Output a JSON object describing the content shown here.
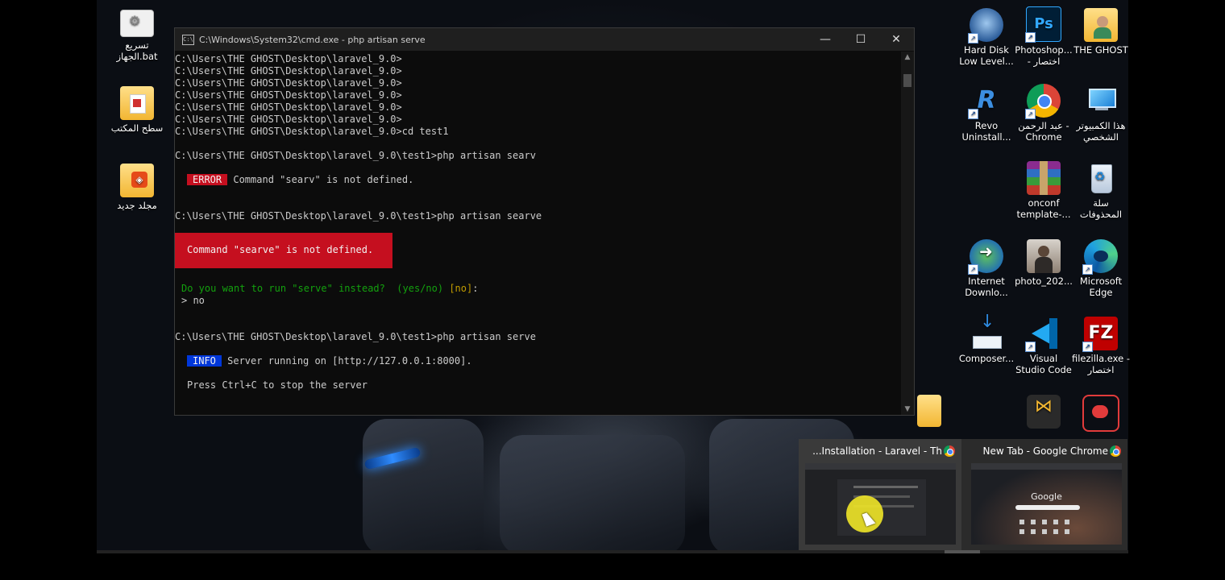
{
  "desktop_icons": {
    "left": [
      {
        "label": "تسريع الجهاز.bat"
      },
      {
        "label": "سطح المكتب"
      },
      {
        "label": "مجلد جديد"
      }
    ],
    "right": [
      {
        "label": "Hard Disk Low Level..."
      },
      {
        "label": "Photoshop... - اختصار"
      },
      {
        "label": "THE GHOST"
      },
      {
        "label": "Revo Uninstall..."
      },
      {
        "label": "عبد الرحمن - Chrome"
      },
      {
        "label": "هذا الكمبيوتر الشخصي"
      },
      {
        "label": "onconf template-..."
      },
      {
        "label": "سلة المحذوفات"
      },
      {
        "label": "Internet Downlo..."
      },
      {
        "label": "photo_202..."
      },
      {
        "label": "Microsoft Edge"
      },
      {
        "label": "Composer..."
      },
      {
        "label": "Visual Studio Code"
      },
      {
        "label": "filezilla.exe - اختصار"
      }
    ]
  },
  "cmd_window": {
    "title": "C:\\Windows\\System32\\cmd.exe - php  artisan serve",
    "minimize": "—",
    "maximize": "☐",
    "close": "✕",
    "lines": {
      "l1": "C:\\Users\\THE GHOST\\Desktop\\laravel_9.0>",
      "l2": "C:\\Users\\THE GHOST\\Desktop\\laravel_9.0>",
      "l3": "C:\\Users\\THE GHOST\\Desktop\\laravel_9.0>",
      "l4": "C:\\Users\\THE GHOST\\Desktop\\laravel_9.0>",
      "l5": "C:\\Users\\THE GHOST\\Desktop\\laravel_9.0>",
      "l6": "C:\\Users\\THE GHOST\\Desktop\\laravel_9.0>",
      "l7": "C:\\Users\\THE GHOST\\Desktop\\laravel_9.0>cd test1",
      "l8": "C:\\Users\\THE GHOST\\Desktop\\laravel_9.0\\test1>php artisan searv",
      "error_tag": "ERROR",
      "error_msg": " Command \"searv\" is not defined.",
      "l9": "C:\\Users\\THE GHOST\\Desktop\\laravel_9.0\\test1>php artisan searve",
      "error_box": "Command \"searve\" is not defined.",
      "question": "Do you want to run \"serve\" instead?  (yes/no)",
      "question_default": " [no]",
      "question_colon": ":",
      "answer": "> no",
      "l10": "C:\\Users\\THE GHOST\\Desktop\\laravel_9.0\\test1>php artisan serve",
      "info_tag": "INFO",
      "info_msg": " Server running on [http://127.0.0.1:8000].",
      "press": "Press Ctrl+C to stop the server"
    }
  },
  "taskbar_previews": [
    {
      "title": "...Installation - Laravel - Th"
    },
    {
      "title": "New Tab - Google Chrome",
      "thumb_text": "Google"
    }
  ],
  "colors": {
    "console_bg": "#0c0c0c",
    "error_red": "#c50f1f",
    "info_blue": "#0037da",
    "prompt_green": "#13a10e",
    "default_yellow": "#c19c00"
  }
}
